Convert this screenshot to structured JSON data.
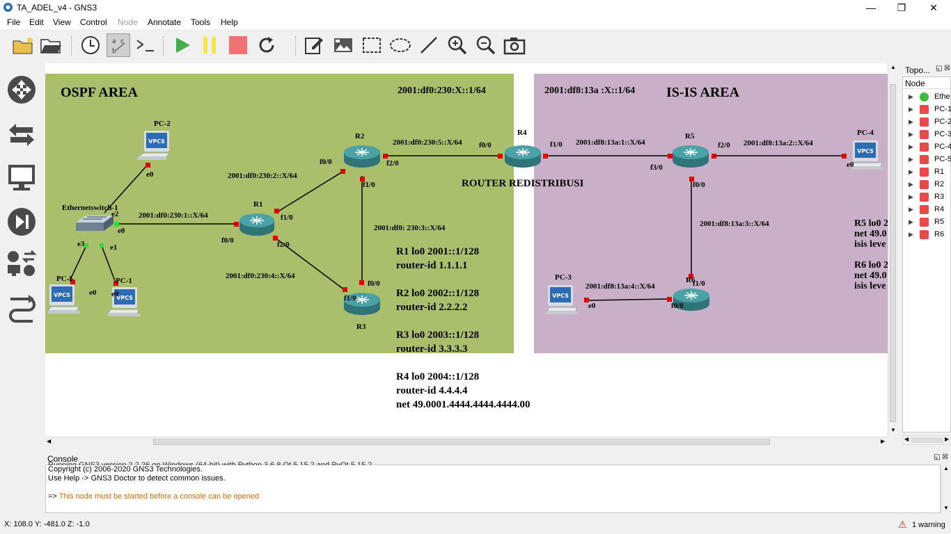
{
  "window": {
    "title": "TA_ADEL_v4 - GNS3",
    "minimize": "—",
    "restore": "❐",
    "close": "✕"
  },
  "menu": [
    {
      "label": "File",
      "enabled": true
    },
    {
      "label": "Edit",
      "enabled": true
    },
    {
      "label": "View",
      "enabled": true
    },
    {
      "label": "Control",
      "enabled": true
    },
    {
      "label": "Node",
      "enabled": false
    },
    {
      "label": "Annotate",
      "enabled": true
    },
    {
      "label": "Tools",
      "enabled": true
    },
    {
      "label": "Help",
      "enabled": true
    }
  ],
  "toolbar": [
    "new-project-icon",
    "open-project-icon",
    "snapshot-icon",
    "show-interface-labels-icon",
    "console-all-icon",
    "start-all-icon",
    "suspend-all-icon",
    "stop-all-icon",
    "reload-all-icon",
    "add-note-icon",
    "insert-picture-icon",
    "draw-rectangle-icon",
    "draw-ellipse-icon",
    "draw-line-icon",
    "zoom-in-icon",
    "zoom-out-icon",
    "screenshot-icon"
  ],
  "left_dock": [
    "browse-routers-icon",
    "browse-switches-icon",
    "browse-end-devices-icon",
    "browse-security-devices-icon",
    "browse-all-devices-icon",
    "add-link-icon"
  ],
  "canvas": {
    "ospf_area": {
      "title": "OSPF AREA",
      "prefix": "2001:df0:230:X::1/64"
    },
    "isis_area": {
      "title": "IS-IS AREA",
      "prefix": "2001:df8:13a :X::1/64"
    },
    "router_redistribusi": "ROUTER REDISTRIBUSI",
    "nodes": {
      "pc2": "PC-2",
      "pc5": "PC-5",
      "pc1": "PC-1",
      "switch": "Ethernetswitch-1",
      "r1": "R1",
      "r2": "R2",
      "r3": "R3",
      "r4": "R4",
      "r5": "R5",
      "r6": "R6",
      "pc3": "PC-3",
      "pc4": "PC-4",
      "vpcs": "VPCS"
    },
    "links": {
      "sw_r1": "2001:df0:230:1::X/64",
      "r1_r2": "2001:df0:230:2::X/64",
      "r1_r3": "2001:df0:230:4::X/64",
      "r2_r3": "2001:df0: 230:3::X/64",
      "r2_r4": "2001:df0:230:5::X/64",
      "r4_r5": "2001:df8:13a:1::X/64",
      "r5_pc4": "2001:df8:13a:2::X/64",
      "r5_r6": "2001:df8:13a:3::X/64",
      "pc3_r6": "2001:df8:13a:4::X/64"
    },
    "ports": {
      "pc2_e0": "e0",
      "sw_e2": "e2",
      "sw_e0": "e0",
      "sw_e3": "e3",
      "sw_e1": "e1",
      "pc5_e0": "e0",
      "pc1_e0": "e0",
      "r1_f00": "f0/0",
      "r1_f10": "f1/0",
      "r1_f20": "f2/0",
      "r2_f00": "f0/0",
      "r2_f10": "f1/0",
      "r2_f20": "f2/0",
      "r3_f00": "f0/0",
      "r3_f10": "f1/0",
      "r4_f00": "f0/0",
      "r4_f10": "f1/0",
      "r5_f30": "f3/0",
      "r5_f20": "f2/0",
      "r5_f00": "f0/0",
      "r6_f10": "f1/0",
      "r6_f00": "f0/0",
      "pc3_e0": "e0",
      "pc4_e0": "e0"
    },
    "notes": [
      "R1 lo0 2001::1/128",
      "router-id 1.1.1.1",
      "R2 lo0 2002::1/128",
      "router-id 2.2.2.2",
      "R3 lo0 2003::1/128",
      "router-id 3.3.3.3",
      "R4 lo0 2004::1/128",
      "router-id 4.4.4.4",
      "net 49.0001.4444.4444.4444.00"
    ],
    "notes_right": [
      "R5 lo0 2",
      "net 49.0",
      "isis leve",
      "R6 lo0 2",
      "net 49.0",
      "isis leve"
    ]
  },
  "topology": {
    "title": "Topo...",
    "column": "Node",
    "items": [
      {
        "label": "Ethe",
        "status": "started"
      },
      {
        "label": "PC-1",
        "status": "stopped"
      },
      {
        "label": "PC-2",
        "status": "stopped"
      },
      {
        "label": "PC-3",
        "status": "stopped"
      },
      {
        "label": "PC-4",
        "status": "stopped"
      },
      {
        "label": "PC-5",
        "status": "stopped"
      },
      {
        "label": "R1",
        "status": "stopped"
      },
      {
        "label": "R2",
        "status": "stopped"
      },
      {
        "label": "R3",
        "status": "stopped"
      },
      {
        "label": "R4",
        "status": "stopped"
      },
      {
        "label": "R5",
        "status": "stopped"
      },
      {
        "label": "R6",
        "status": "stopped"
      }
    ]
  },
  "console": {
    "title": "Console",
    "line0": "Running GNS3 version 2.2.26 on Windows (64-bit) with Python 3.6.8 Qt 5.15.2 and PyQt 5.15.2.",
    "line1": "Copyright (c) 2006-2020 GNS3 Technologies.",
    "line2": "Use Help -> GNS3 Doctor to detect common issues.",
    "prompt": "=>",
    "message": "This node must be started before a console can be opened"
  },
  "status": {
    "coords": "X: 108.0 Y: -481.0 Z: -1.0",
    "warning": "1 warning"
  },
  "colors": {
    "ospf": "#a9bf6c",
    "isis": "#c9b0c8",
    "link_dot": "#e00000",
    "router": "#3e8e93",
    "warn_text": "#d96a00"
  }
}
